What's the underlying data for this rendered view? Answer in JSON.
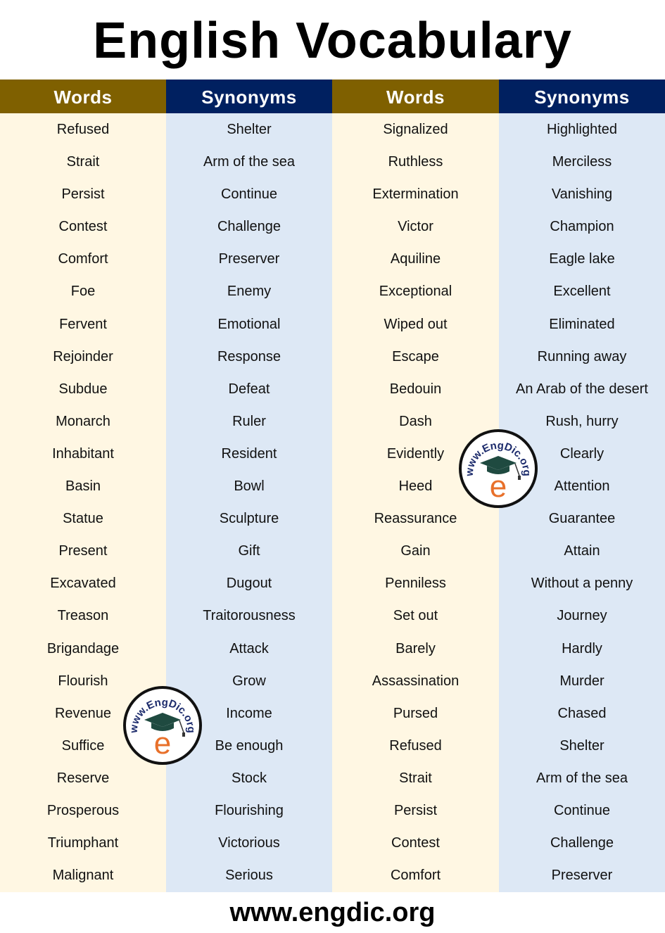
{
  "title": "English Vocabulary",
  "columns": [
    {
      "header": "Words",
      "type": "words",
      "items": [
        "Refused",
        "Strait",
        "Persist",
        "Contest",
        "Comfort",
        "Foe",
        "Fervent",
        "Rejoinder",
        "Subdue",
        "Monarch",
        "Inhabitant",
        "Basin",
        "Statue",
        "Present",
        "Excavated",
        "Treason",
        "Brigandage",
        "Flourish",
        "Revenue",
        "Suffice",
        "Reserve",
        "Prosperous",
        "Triumphant",
        "Malignant"
      ]
    },
    {
      "header": "Synonyms",
      "type": "syn",
      "items": [
        "Shelter",
        "Arm of the sea",
        "Continue",
        "Challenge",
        "Preserver",
        "Enemy",
        "Emotional",
        "Response",
        "Defeat",
        "Ruler",
        "Resident",
        "Bowl",
        "Sculpture",
        "Gift",
        "Dugout",
        "Traitorousness",
        "Attack",
        "Grow",
        "Income",
        "Be enough",
        "Stock",
        "Flourishing",
        "Victorious",
        "Serious"
      ]
    },
    {
      "header": "Words",
      "type": "words",
      "items": [
        "Signalized",
        "Ruthless",
        "Extermination",
        "Victor",
        "Aquiline",
        "Exceptional",
        "Wiped out",
        "Escape",
        "Bedouin",
        "Dash",
        "Evidently",
        "Heed",
        "Reassurance",
        "Gain",
        "Penniless",
        "Set out",
        "Barely",
        "Assassination",
        "Pursed",
        "Refused",
        "Strait",
        "Persist",
        "Contest",
        "Comfort"
      ]
    },
    {
      "header": "Synonyms",
      "type": "syn",
      "items": [
        "Highlighted",
        "Merciless",
        "Vanishing",
        "Champion",
        "Eagle lake",
        "Excellent",
        "Eliminated",
        "Running away",
        "An Arab of the desert",
        "Rush, hurry",
        "Clearly",
        "Attention",
        "Guarantee",
        "Attain",
        "Without a penny",
        "Journey",
        "Hardly",
        "Murder",
        "Chased",
        "Shelter",
        "Arm of the sea",
        "Continue",
        "Challenge",
        "Preserver"
      ]
    }
  ],
  "logo": {
    "text": "www.EngDic.org",
    "letter": "e",
    "text_color": "#1b2a6b",
    "letter_color": "#e8702a",
    "cap_color": "#1f4a40"
  },
  "colors": {
    "words_header": "#7f6000",
    "syn_header": "#002060",
    "words_bg": "#fff7e3",
    "syn_bg": "#dde8f5"
  },
  "footer": "www.engdic.org"
}
